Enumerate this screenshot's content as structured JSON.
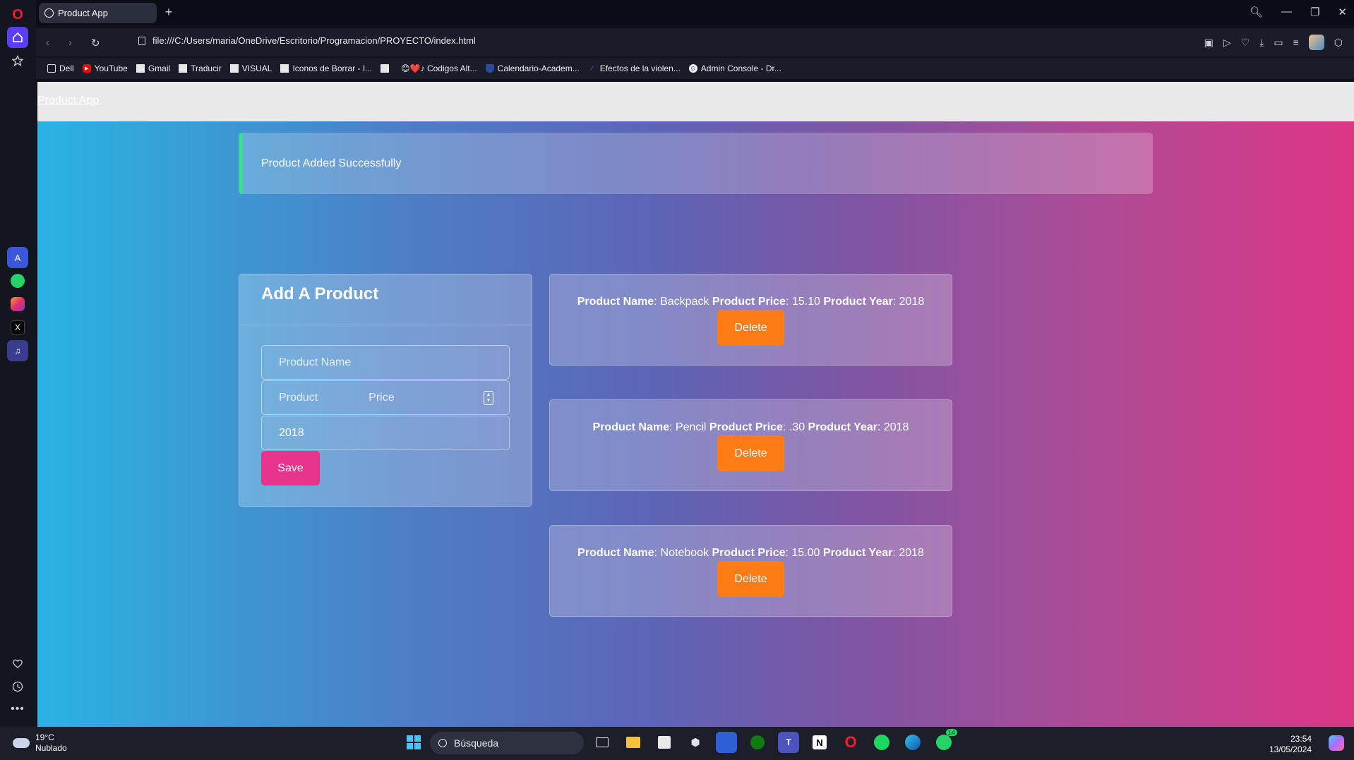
{
  "browser": {
    "tab_title": "Product App",
    "url": "file:///C:/Users/maria/OneDrive/Escritorio/Programacion/PROYECTO/index.html",
    "bookmarks": [
      {
        "label": "Dell"
      },
      {
        "label": "YouTube"
      },
      {
        "label": "Gmail"
      },
      {
        "label": "Traducir"
      },
      {
        "label": "VISUAL"
      },
      {
        "label": "Iconos de Borrar - I..."
      },
      {
        "label": ""
      },
      {
        "label": "😊❤️♪ Codigos Alt..."
      },
      {
        "label": "Calendario-Academ..."
      },
      {
        "label": "Efectos de la violen..."
      },
      {
        "label": "Admin Console - Dr..."
      }
    ]
  },
  "page": {
    "brand": "Product App",
    "alert": "Product Added Successfully",
    "form": {
      "title": "Add A Product",
      "name_placeholder": "Product Name",
      "price_placeholder_left": "Product",
      "price_placeholder_right": "Price",
      "year_value": "2018",
      "save_label": "Save"
    },
    "products": [
      {
        "name_label": "Product Name",
        "name": "Backpack",
        "price_label": "Product Price",
        "price": "15.10",
        "year_label": "Product Year",
        "year": "2018",
        "delete_label": "Delete"
      },
      {
        "name_label": "Product Name",
        "name": "Pencil",
        "price_label": "Product Price",
        "price": ".30",
        "year_label": "Product Year",
        "year": "2018",
        "delete_label": "Delete"
      },
      {
        "name_label": "Product Name",
        "name": "Notebook",
        "price_label": "Product Price",
        "price": "15.00",
        "year_label": "Product Year",
        "year": "2018",
        "delete_label": "Delete"
      }
    ]
  },
  "taskbar": {
    "weather_temp": "19°C",
    "weather_desc": "Nublado",
    "search_label": "Búsqueda",
    "time": "23:54",
    "date": "13/05/2024",
    "whatsapp_badge": "14"
  },
  "colors": {
    "save_button": "#e8338a",
    "delete_button": "#fe7c16",
    "alert_accent": "#3ddc97"
  }
}
